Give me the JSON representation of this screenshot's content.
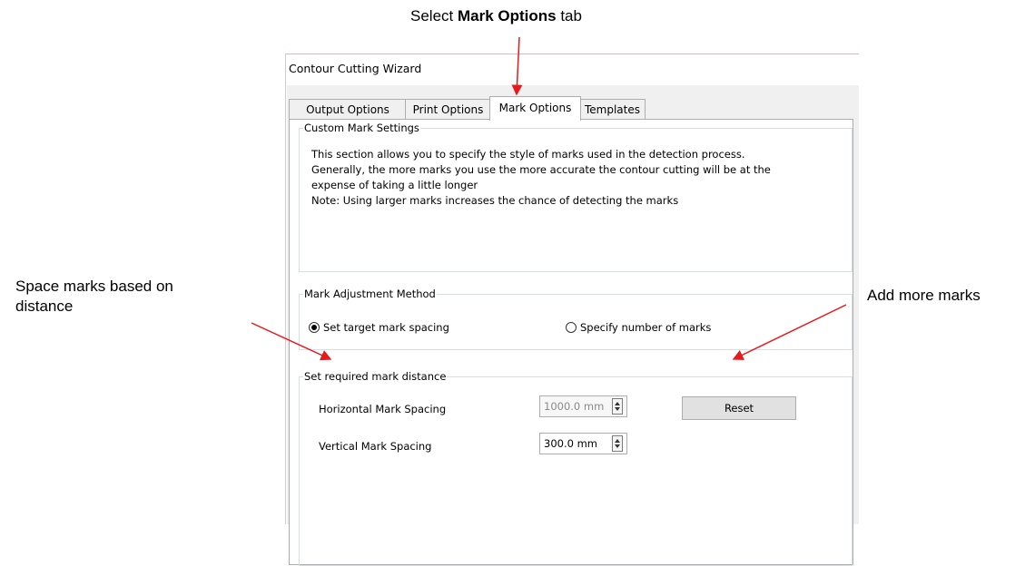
{
  "callouts": {
    "top_prefix": "Select ",
    "top_bold": "Mark Options",
    "top_suffix": " tab",
    "left_line1": "Space marks based on",
    "left_line2": "distance",
    "right": "Add more marks"
  },
  "window": {
    "title": "Contour Cutting Wizard"
  },
  "tabs": [
    {
      "label": "Output Options",
      "active": false
    },
    {
      "label": "Print Options",
      "active": false
    },
    {
      "label": "Mark Options",
      "active": true
    },
    {
      "label": "Templates",
      "active": false
    }
  ],
  "custom_mark": {
    "legend": "Custom Mark Settings",
    "lines": [
      "This section allows you to specify the style of marks used in the detection process.",
      "Generally, the more marks you use the more accurate the contour cutting will be at the",
      "expense of taking a little longer",
      "Note: Using larger marks increases the chance of detecting the marks"
    ]
  },
  "adjustment": {
    "legend": "Mark Adjustment Method",
    "option1": {
      "label": "Set target mark spacing",
      "selected": true
    },
    "option2": {
      "label": "Specify number of marks",
      "selected": false
    }
  },
  "distance": {
    "legend": "Set required mark distance",
    "horizontal_label": "Horizontal Mark Spacing",
    "horizontal_value": "1000.0 mm",
    "horizontal_enabled": false,
    "vertical_label": "Vertical Mark Spacing",
    "vertical_value": "300.0 mm",
    "reset_label": "Reset"
  },
  "colors": {
    "arrow": "#e8191c"
  }
}
